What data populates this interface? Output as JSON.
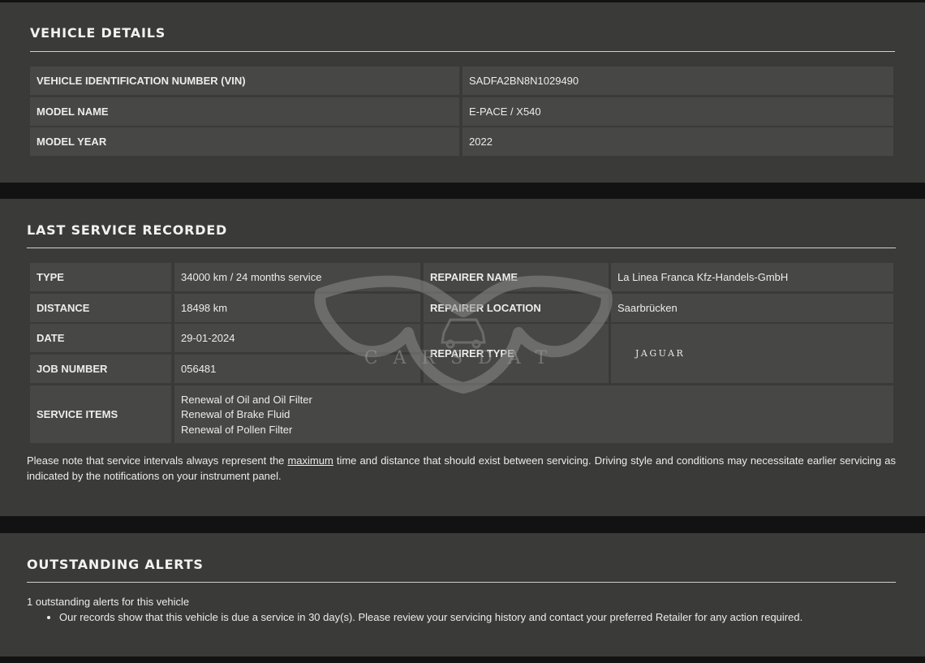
{
  "vehicle_details": {
    "title": "VEHICLE DETAILS",
    "rows": [
      {
        "label": "VEHICLE IDENTIFICATION NUMBER (VIN)",
        "value": "SADFA2BN8N1029490"
      },
      {
        "label": "MODEL NAME",
        "value": "E-PACE / X540"
      },
      {
        "label": "MODEL YEAR",
        "value": "2022"
      }
    ]
  },
  "last_service": {
    "title": "LAST SERVICE RECORDED",
    "type_label": "TYPE",
    "type_value": "34000 km / 24 months service",
    "distance_label": "DISTANCE",
    "distance_value": "18498 km",
    "date_label": "DATE",
    "date_value": "29-01-2024",
    "job_label": "JOB NUMBER",
    "job_value": "056481",
    "repairer_name_label": "REPAIRER NAME",
    "repairer_name_value": "La Linea Franca Kfz-Handels-GmbH",
    "repairer_location_label": "REPAIRER LOCATION",
    "repairer_location_value": "Saarbrücken",
    "repairer_type_label": "REPAIRER TYPE",
    "repairer_type_logo": "JAGUAR",
    "service_items_label": "SERVICE ITEMS",
    "service_items": [
      "Renewal of Oil and Oil Filter",
      "Renewal of Brake Fluid",
      "Renewal of Pollen Filter"
    ],
    "note_before": "Please note that service intervals always represent the ",
    "note_link": "maximum",
    "note_after": " time and distance that should exist between servicing. Driving style and conditions may necessitate earlier servicing as indicated by the notifications on your instrument panel."
  },
  "outstanding_alerts": {
    "title": "OUTSTANDING ALERTS",
    "count_text": "1 outstanding alerts for this vehicle",
    "items": [
      "Our records show that this vehicle is due a service in 30 day(s). Please review your servicing history and contact your preferred Retailer for any action required."
    ]
  },
  "watermark": {
    "text": "CARSDAT",
    "icon": "bat-wing-car-icon"
  },
  "colors": {
    "page_background": "#121212",
    "section_background": "#3a3a38",
    "cell_background": "#474745",
    "text": "#ececec"
  }
}
